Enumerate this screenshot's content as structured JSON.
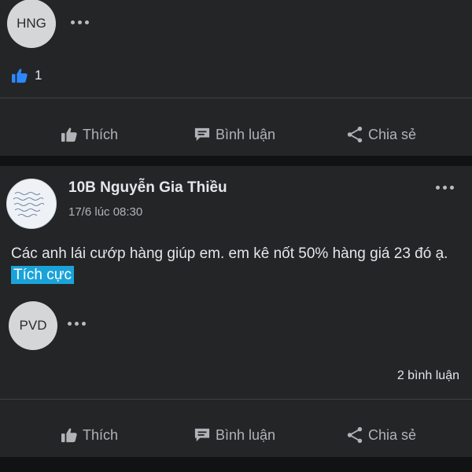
{
  "post1": {
    "commenter_initials": "HNG",
    "like_count": "1",
    "actions": {
      "like": "Thích",
      "comment": "Bình luận",
      "share": "Chia sẻ"
    }
  },
  "post2": {
    "author": "10B Nguyễn Gia Thiều",
    "time": "17/6 lúc 08:30",
    "text": "Các anh lái cướp hàng giúp em. em kê nốt 50% hàng giá 23 đó ạ.",
    "tag": "Tích cực",
    "commenter_initials": "PVD",
    "comment_count": "2 bình luận",
    "actions": {
      "like": "Thích",
      "comment": "Bình luận",
      "share": "Chia sẻ"
    }
  },
  "colors": {
    "background": "#111214",
    "card": "#242526",
    "text": "#e4e6eb",
    "muted": "#b0b3b8",
    "like_blue": "#2d88ff",
    "tag_bg": "#1aa3d9"
  }
}
